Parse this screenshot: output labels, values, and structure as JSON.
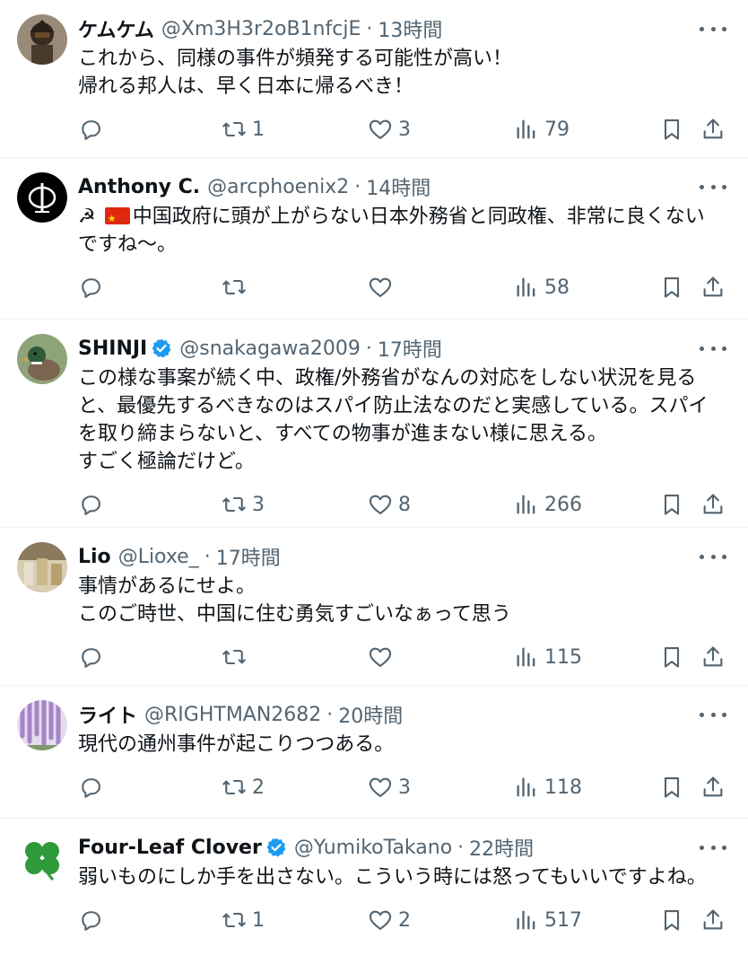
{
  "colors": {
    "text": "#0f1419",
    "muted": "#536471",
    "verified": "#1d9bf0",
    "divider": "#eff3f4"
  },
  "tweets": [
    {
      "name": "ケムケム",
      "verified": false,
      "handle": "@Xm3H3r2oB1nfcjE",
      "time": "13時間",
      "text": "これから、同様の事件が頻発する可能性が高い！\n帰れる邦人は、早く日本に帰るべき！",
      "retweets": "1",
      "likes": "3",
      "views": "79"
    },
    {
      "name": "Anthony C.",
      "verified": false,
      "handle": "@arcphoenix2",
      "time": "14時間",
      "prefix": "☭",
      "text": "中国政府に頭が上がらない日本外務省と同政権、非常に良くないですね〜。",
      "retweets": "",
      "likes": "",
      "views": "58"
    },
    {
      "name": "SHINJI",
      "verified": true,
      "handle": "@snakagawa2009",
      "time": "17時間",
      "text": "この様な事案が続く中、政権/外務省がなんの対応をしない状況を見ると、最優先するべきなのはスパイ防止法なのだと実感している。スパイを取り締まらないと、すべての物事が進まない様に思える。\nすごく極論だけど。",
      "retweets": "3",
      "likes": "8",
      "views": "266"
    },
    {
      "name": "Lio",
      "verified": false,
      "handle": "@Lioxe_",
      "time": "17時間",
      "text": "事情があるにせよ。\nこのご時世、中国に住む勇気すごいなぁって思う",
      "retweets": "",
      "likes": "",
      "views": "115"
    },
    {
      "name": "ライト",
      "verified": false,
      "handle": "@RIGHTMAN2682",
      "time": "20時間",
      "text": "現代の通州事件が起こりつつある。",
      "retweets": "2",
      "likes": "3",
      "views": "118"
    },
    {
      "name": "Four-Leaf Clover",
      "verified": true,
      "handle": "@YumikoTakano",
      "time": "22時間",
      "text": "弱いものにしか手を出さない。こういう時には怒ってもいいですよね。",
      "retweets": "1",
      "likes": "2",
      "views": "517"
    }
  ],
  "avatars": [
    "samurai-avatar",
    "phi-logo-avatar",
    "duck-avatar",
    "photo-avatar",
    "wisteria-avatar",
    "clover-avatar"
  ]
}
